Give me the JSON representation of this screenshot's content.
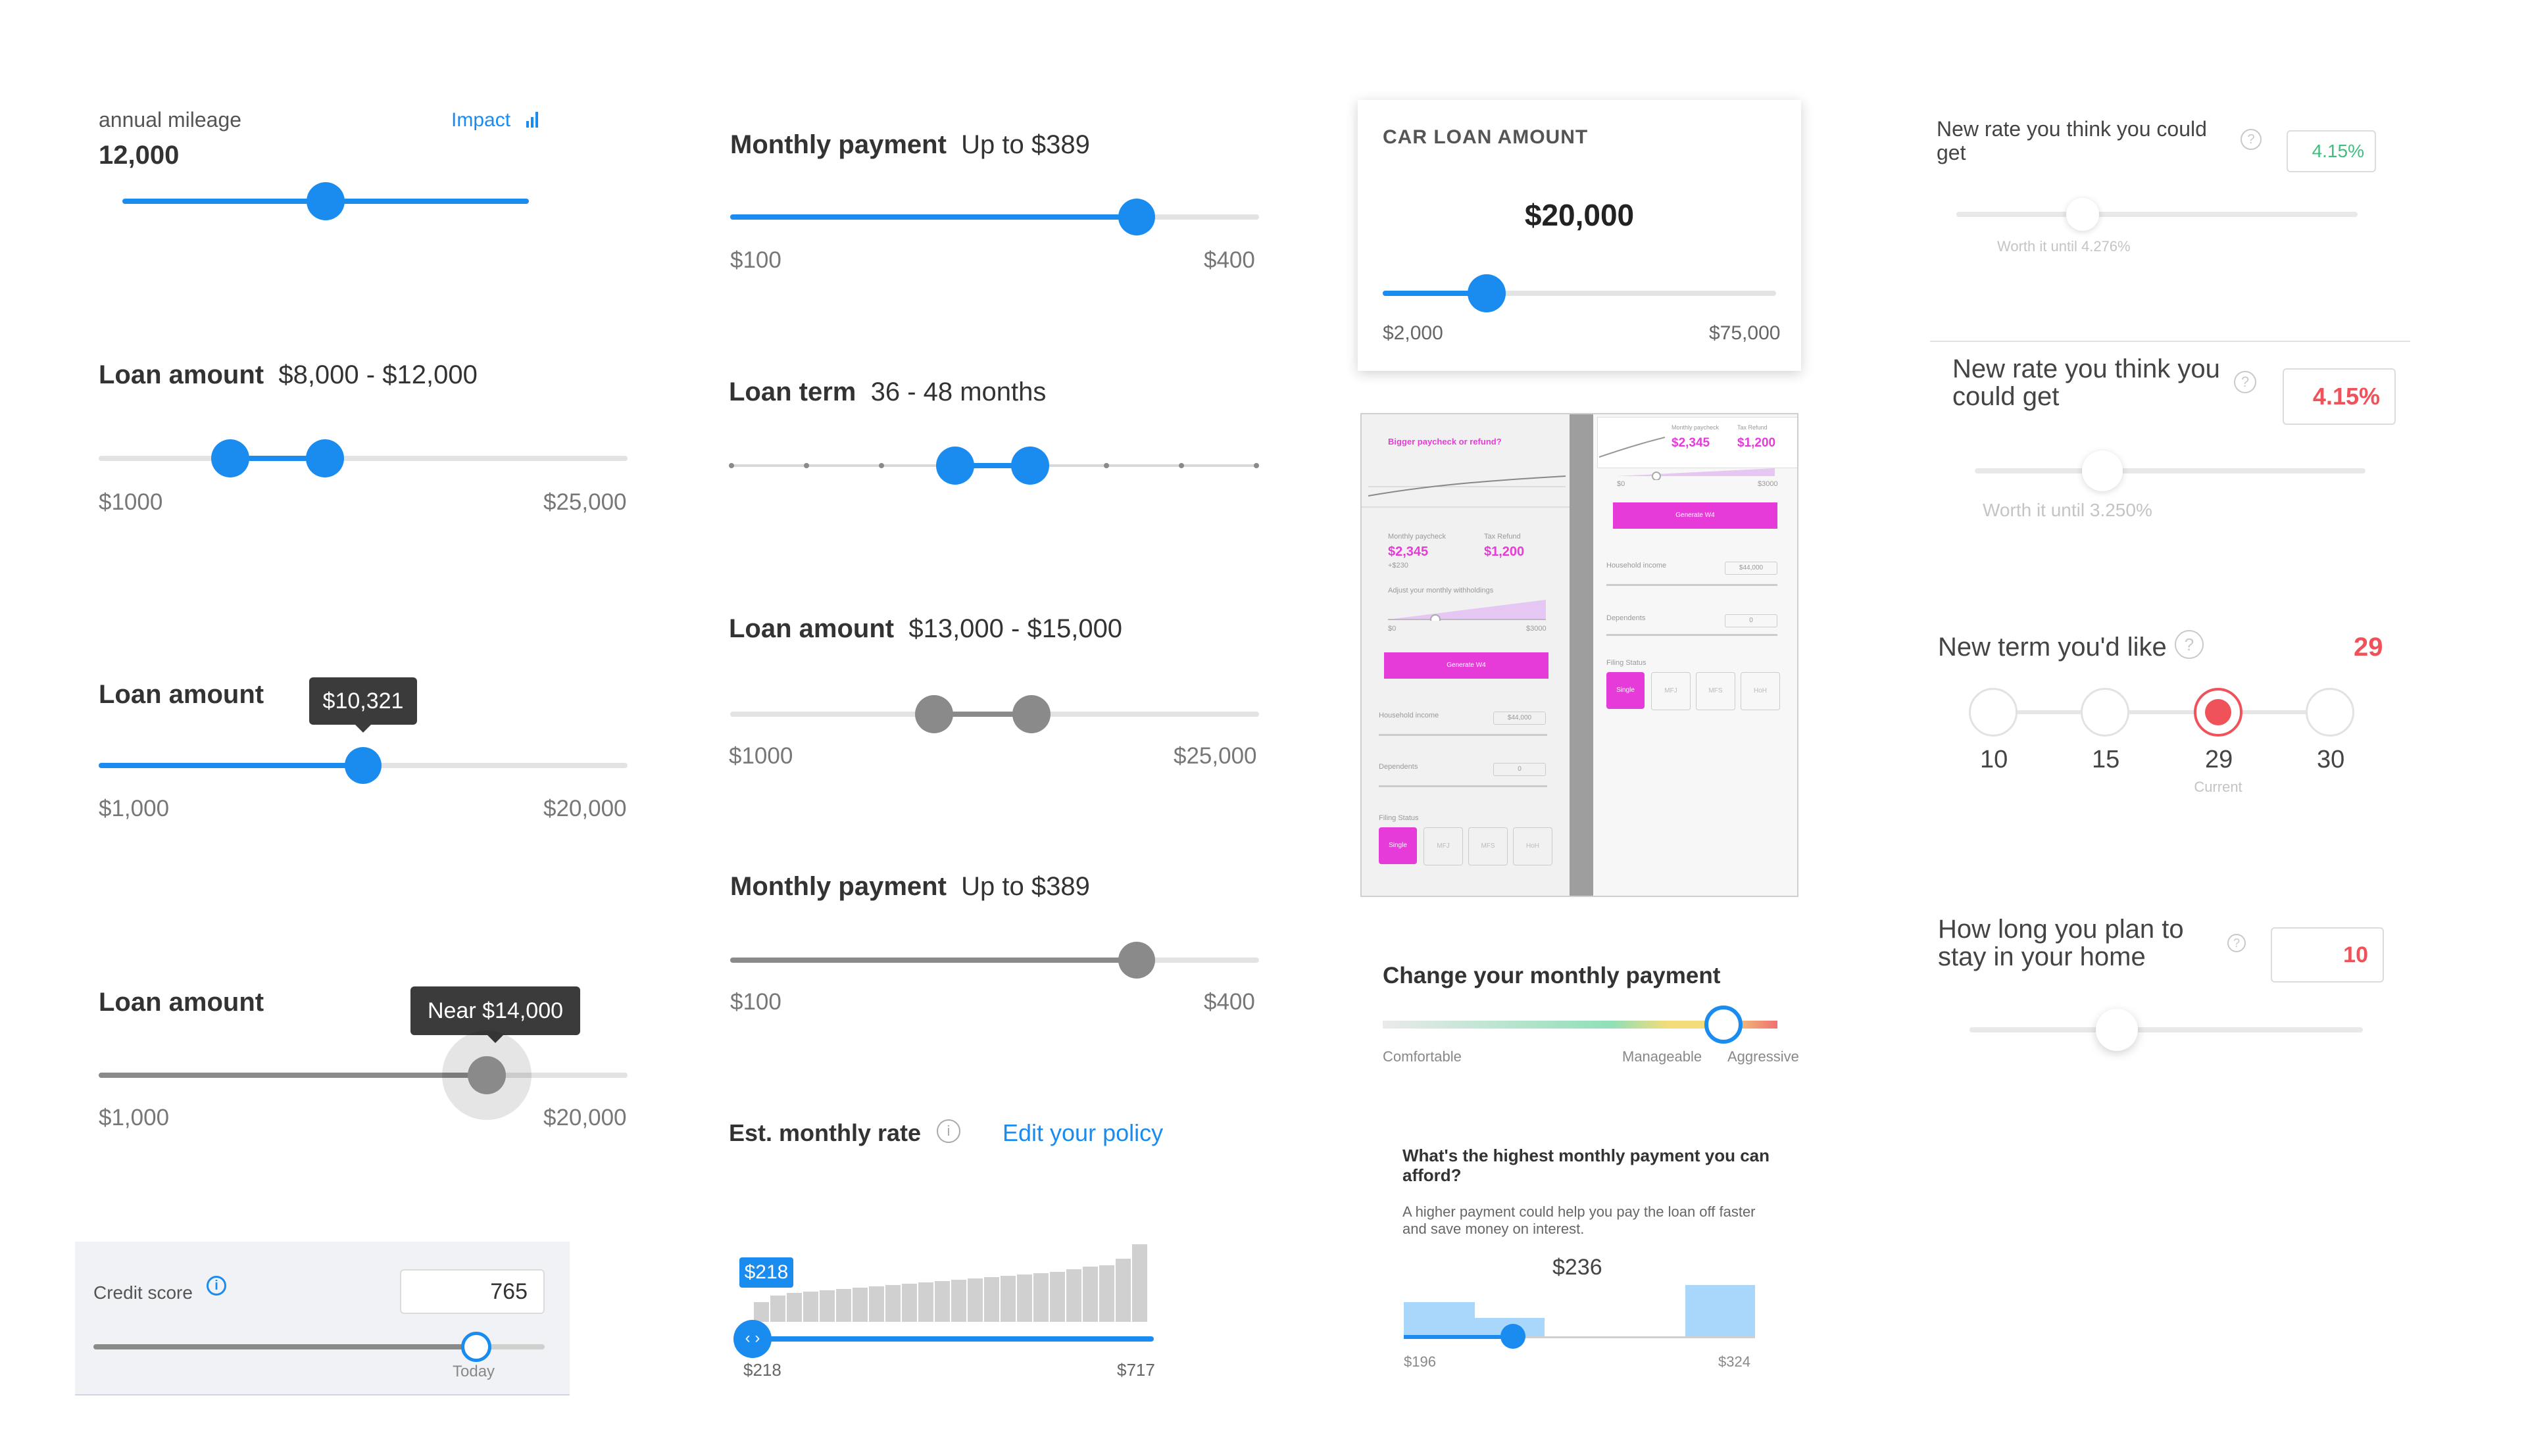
{
  "mileage": {
    "label": "annual mileage",
    "value": "12,000",
    "impact_link": "Impact",
    "fraction": 0.5
  },
  "loan_range1": {
    "label": "Loan amount",
    "value": "$8,000 - $12,000",
    "min": "$1000",
    "max": "$25,000"
  },
  "loan_tooltip": {
    "label": "Loan amount",
    "tooltip": "$10,321",
    "min": "$1,000",
    "max": "$20,000",
    "fraction": 0.5
  },
  "loan_near": {
    "label": "Loan amount",
    "tooltip": "Near $14,000",
    "min": "$1,000",
    "max": "$20,000"
  },
  "credit": {
    "label": "Credit score",
    "value": "765",
    "marker": "Today"
  },
  "monthly1": {
    "label": "Monthly payment",
    "value": "Up to $389",
    "min": "$100",
    "max": "$400"
  },
  "loan_term": {
    "label": "Loan term",
    "value": "36 - 48 months"
  },
  "loan_range2": {
    "label": "Loan amount",
    "value": "$13,000 - $15,000",
    "min": "$1000",
    "max": "$25,000"
  },
  "monthly2": {
    "label": "Monthly payment",
    "value": "Up to $389",
    "min": "$100",
    "max": "$400"
  },
  "est_rate": {
    "label": "Est. monthly rate",
    "edit_link": "Edit your policy",
    "badge": "$218",
    "min": "$218",
    "max": "$717"
  },
  "car_loan": {
    "title": "CAR LOAN AMOUNT",
    "value": "$20,000",
    "min": "$2,000",
    "max": "$75,000"
  },
  "mock": {
    "title": "Bigger paycheck or refund?",
    "monthly_paycheck_label": "Monthly paycheck",
    "tax_refund_label": "Tax Refund",
    "paycheck": "$2,345",
    "refund": "$1,200",
    "delta": "+$230",
    "adjust": "Adjust your monthly withholdings",
    "min": "$0",
    "max": "$3000",
    "generate": "Generate W4",
    "household": "Household income",
    "household_value": "$44,000",
    "dependents": "Dependents",
    "dependents_value": "0",
    "filing": "Filing Status",
    "filing_options": [
      "Single",
      "MFJ",
      "MFS",
      "HoH"
    ]
  },
  "change_payment": {
    "label": "Change your monthly payment",
    "zones": [
      "Comfortable",
      "Manageable",
      "Aggressive"
    ]
  },
  "highest": {
    "question": "What's the highest monthly payment you can afford?",
    "body": "A higher payment could help you pay the loan off faster and save money on interest.",
    "value": "$236",
    "min": "$196",
    "max": "$324"
  },
  "new_rate1": {
    "label": "New rate you think you could get",
    "value": "4.15%",
    "hint": "Worth it until 4.276%",
    "help": "?"
  },
  "new_rate2": {
    "label": "New rate you think you could get",
    "value": "4.15%",
    "hint": "Worth it until 3.250%",
    "help": "?"
  },
  "new_term": {
    "label": "New term you'd like",
    "value": "29",
    "help": "?",
    "options": [
      "10",
      "15",
      "29",
      "30"
    ],
    "current_label": "Current"
  },
  "stay": {
    "label": "How long you plan to stay in your home",
    "value": "10",
    "help": "?"
  },
  "colors": {
    "blue": "#1a8cf0",
    "gray": "#8a8a8a",
    "green": "#3fbf7f",
    "red": "#f0525a",
    "pink": "#e63bd9"
  }
}
